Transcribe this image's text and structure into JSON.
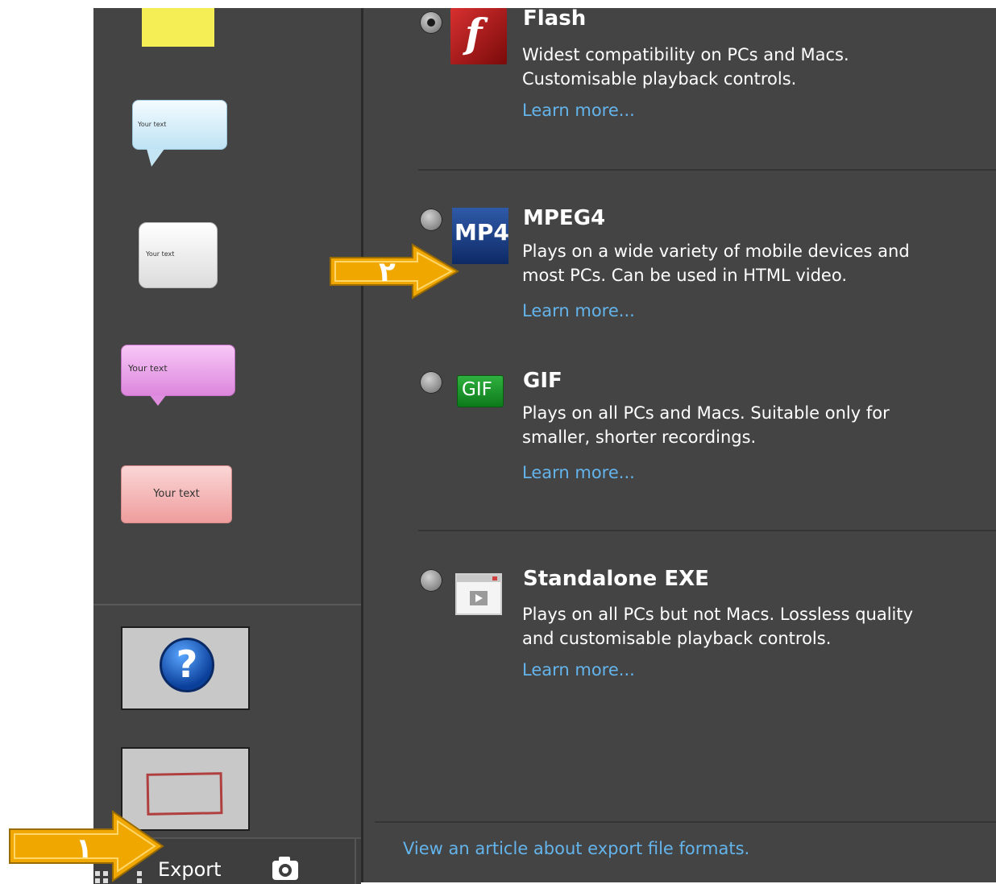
{
  "sidebar": {
    "callouts": [
      {
        "text": "Your text"
      },
      {
        "text": "Your text"
      },
      {
        "text": "Your text"
      },
      {
        "text": "Your text"
      }
    ],
    "footer": {
      "export_label": "Export"
    }
  },
  "formats": [
    {
      "title": "Flash",
      "description": "Widest compatibility on PCs and Macs.\nCustomisable playback controls.",
      "link": "Learn more...",
      "selected": true,
      "icon": "flash-icon"
    },
    {
      "title": "MPEG4",
      "description": "Plays on a wide variety of mobile devices and\nmost PCs. Can be used in HTML video.",
      "link": "Learn more...",
      "selected": false,
      "icon": "mp4-icon",
      "icon_text": "MP4"
    },
    {
      "title": "GIF",
      "description": "Plays on all PCs and Macs. Suitable only for\nsmaller, shorter recordings.",
      "link": "Learn more...",
      "selected": false,
      "icon": "gif-icon",
      "icon_text": "GIF"
    },
    {
      "title": "Standalone EXE",
      "description": "Plays on all PCs but not Macs. Lossless quality\nand customisable playback controls.",
      "link": "Learn more...",
      "selected": false,
      "icon": "exe-window-icon"
    }
  ],
  "footer_link": "View an article about export file formats.",
  "annotations": [
    {
      "label": "١",
      "target": "export"
    },
    {
      "label": "٢",
      "target": "mpeg4"
    }
  ],
  "colors": {
    "panel_bg": "#444444",
    "link": "#64b4ec",
    "arrow": "#f0a800"
  }
}
